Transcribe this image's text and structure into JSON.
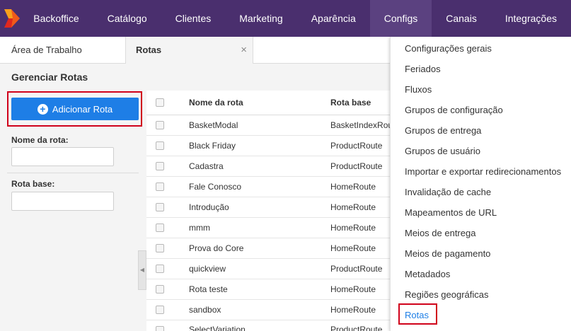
{
  "nav": {
    "items": [
      "Backoffice",
      "Catálogo",
      "Clientes",
      "Marketing",
      "Aparência",
      "Configs",
      "Canais",
      "Integrações"
    ],
    "active": "Configs",
    "bg_color": "#4a2f6e"
  },
  "tabs": [
    {
      "label": "Área de Trabalho"
    },
    {
      "label": "Rotas",
      "close_icon": "×"
    }
  ],
  "page": {
    "title": "Gerenciar Rotas",
    "add_button_label": "Adicionar Rota",
    "add_button_color": "#1e7ee6",
    "filters": {
      "route_name_label": "Nome da rota:",
      "route_name_value": "",
      "base_route_label": "Rota base:",
      "base_route_value": ""
    }
  },
  "table": {
    "columns": [
      "Nome da rota",
      "Rota base"
    ],
    "rows": [
      {
        "name": "BasketModal",
        "base": "BasketIndexRoute"
      },
      {
        "name": "Black Friday",
        "base": "ProductRoute"
      },
      {
        "name": "Cadastra",
        "base": "ProductRoute"
      },
      {
        "name": "Fale Conosco",
        "base": "HomeRoute"
      },
      {
        "name": "Introdução",
        "base": "HomeRoute"
      },
      {
        "name": "mmm",
        "base": "HomeRoute"
      },
      {
        "name": "Prova do Core",
        "base": "HomeRoute"
      },
      {
        "name": "quickview",
        "base": "ProductRoute"
      },
      {
        "name": "Rota teste",
        "base": "HomeRoute"
      },
      {
        "name": "sandbox",
        "base": "HomeRoute"
      },
      {
        "name": "SelectVariation",
        "base": "ProductRoute"
      }
    ]
  },
  "configs_menu": {
    "items": [
      "Configurações gerais",
      "Feriados",
      "Fluxos",
      "Grupos de configuração",
      "Grupos de entrega",
      "Grupos de usuário",
      "Importar e exportar redirecionamentos",
      "Invalidação de cache",
      "Mapeamentos de URL",
      "Meios de entrega",
      "Meios de pagamento",
      "Metadados",
      "Regiões geográficas",
      "Rotas"
    ],
    "active": "Rotas",
    "active_color": "#1e7ee6"
  },
  "highlight_color": "#d0021b"
}
